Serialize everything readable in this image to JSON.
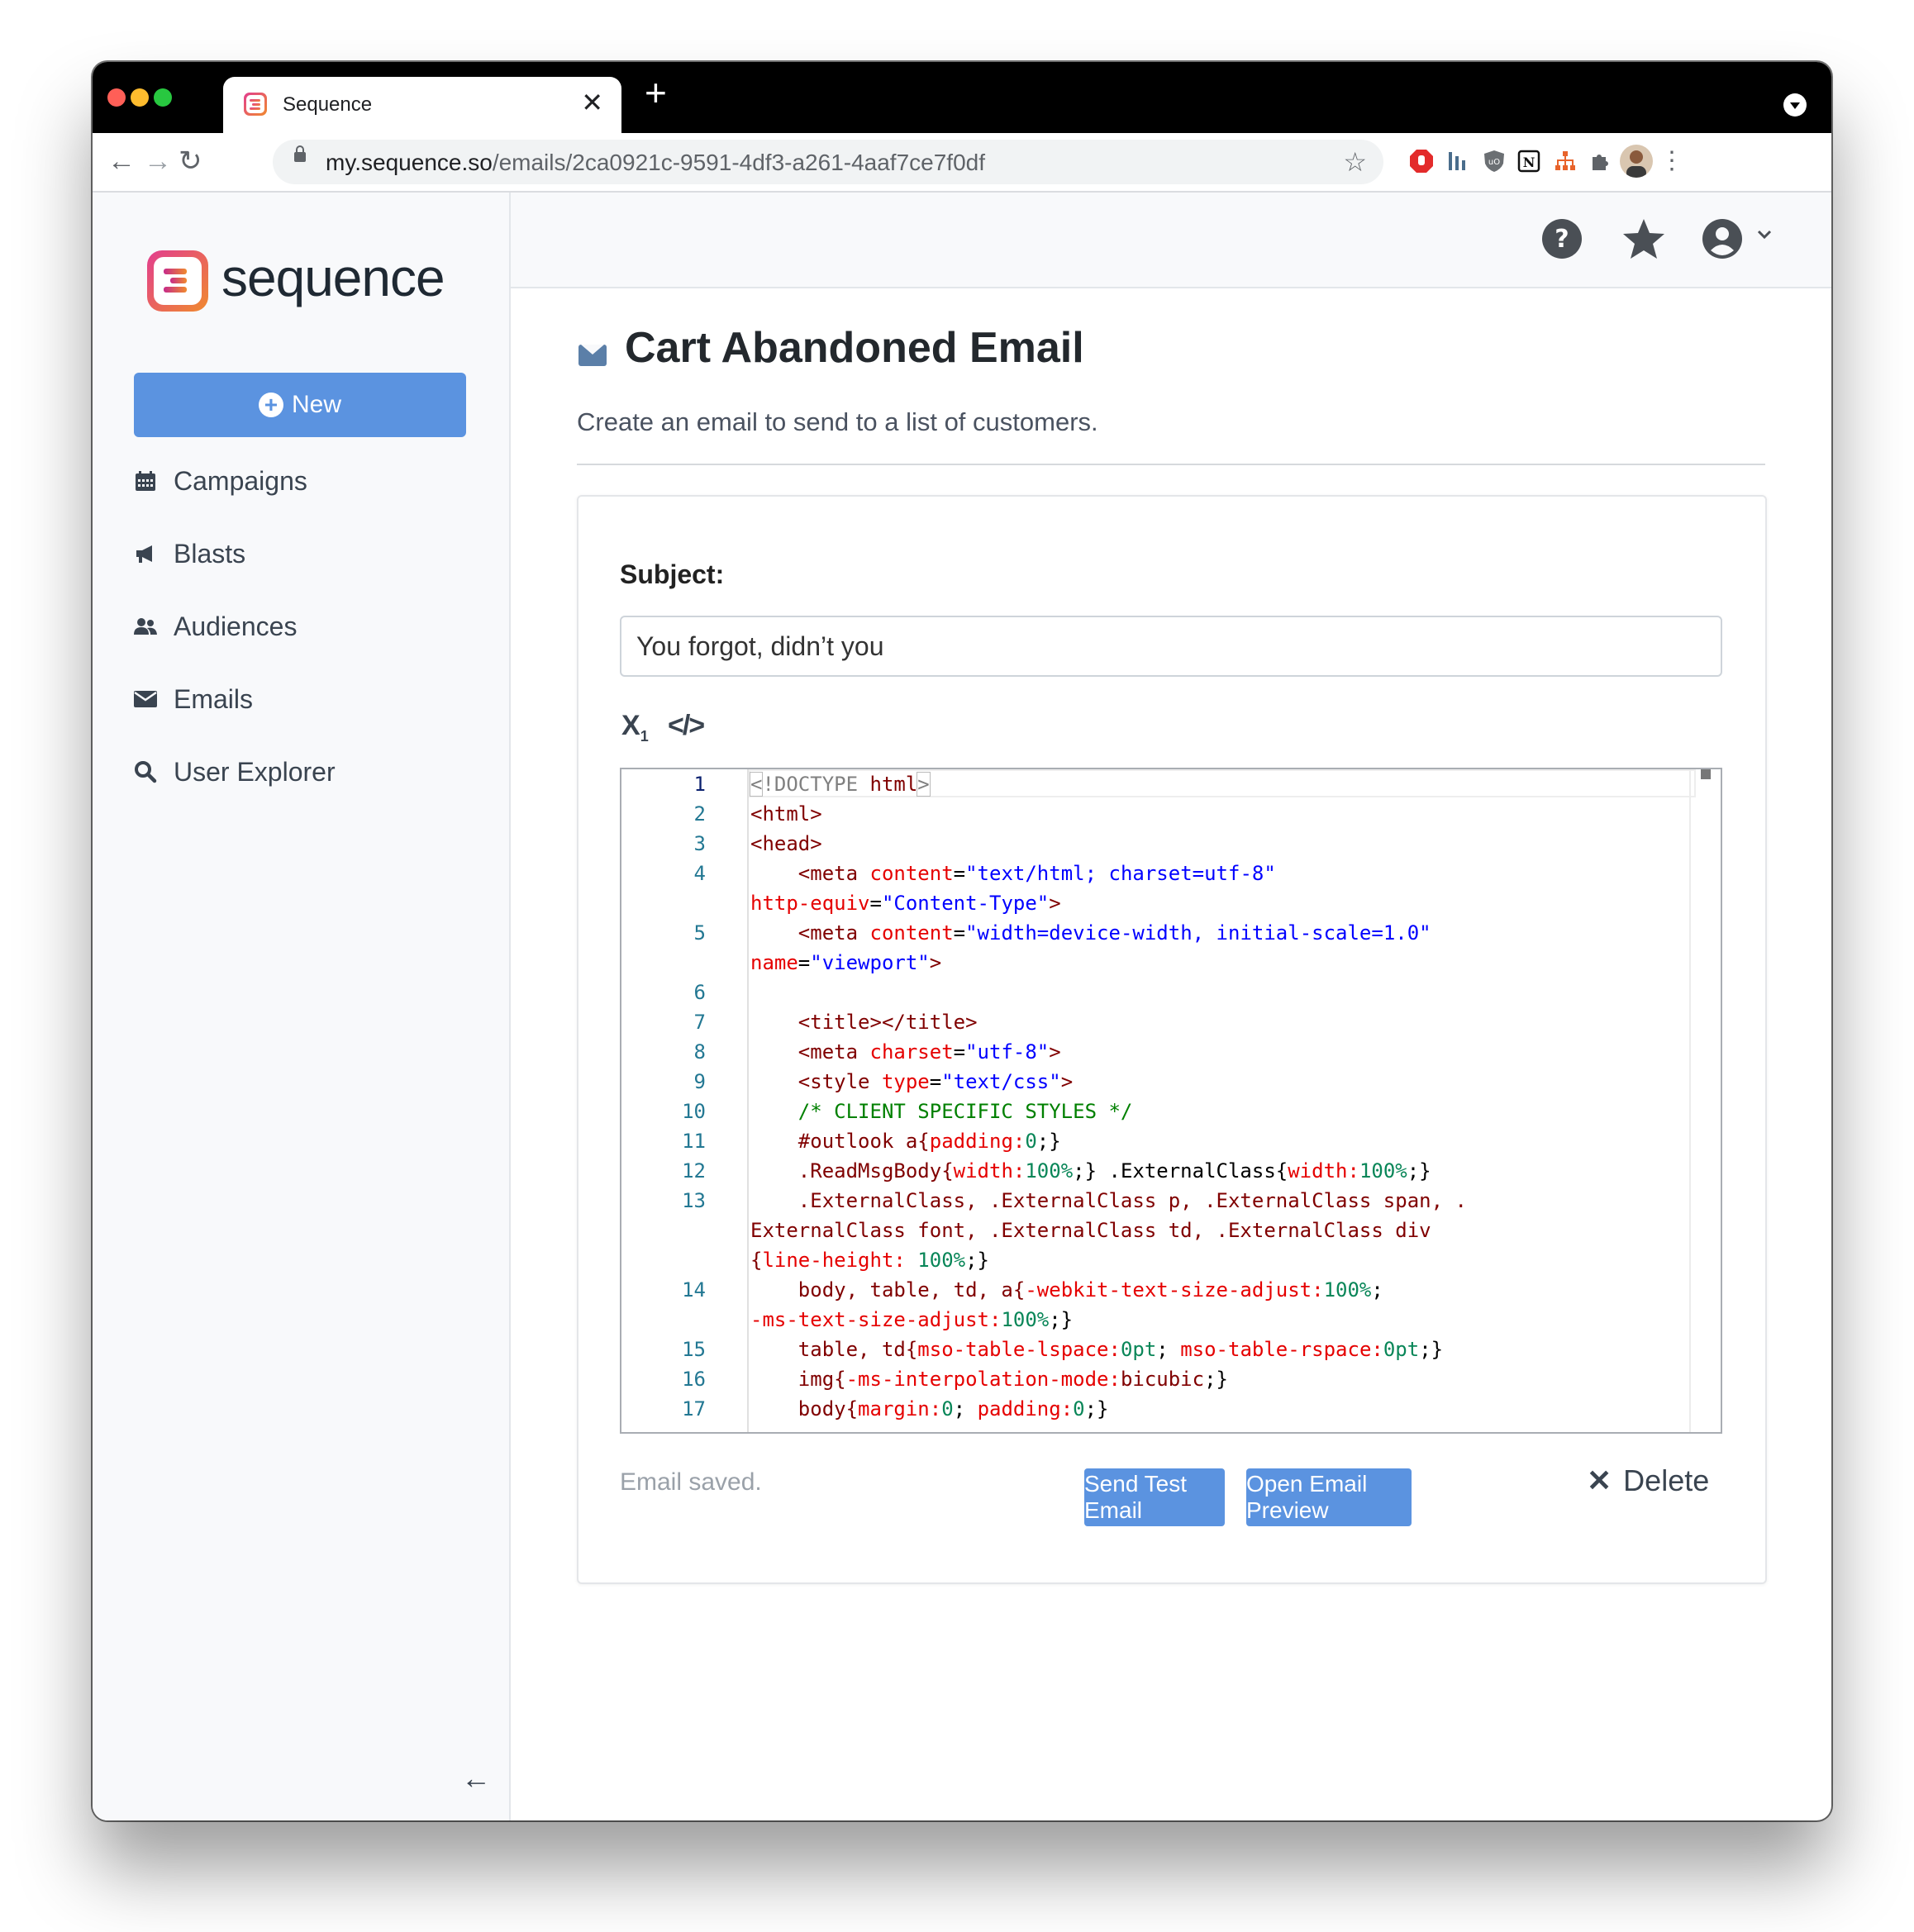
{
  "browser": {
    "tab_title": "Sequence",
    "url_host": "my.sequence.so",
    "url_path": "/emails/2ca0921c-9591-4df3-a261-4aaf7ce7f0df"
  },
  "sidebar": {
    "logo_text": "sequence",
    "new_button": "New",
    "items": [
      {
        "label": "Campaigns",
        "icon": "calendar-icon"
      },
      {
        "label": "Blasts",
        "icon": "megaphone-icon"
      },
      {
        "label": "Audiences",
        "icon": "users-icon"
      },
      {
        "label": "Emails",
        "icon": "envelope-icon"
      },
      {
        "label": "User Explorer",
        "icon": "search-icon"
      }
    ]
  },
  "page": {
    "title": "Cart Abandoned Email",
    "subtitle": "Create an email to send to a list of customers."
  },
  "form": {
    "subject_label": "Subject:",
    "subject_value": "You forgot, didn’t you",
    "status": "Email saved.",
    "send_test": "Send Test Email",
    "open_preview": "Open Email Preview",
    "delete": "Delete"
  },
  "editor": {
    "line_numbers": [
      "1",
      "2",
      "3",
      "4",
      "",
      "5",
      "",
      "6",
      "7",
      "8",
      "9",
      "10",
      "11",
      "12",
      "13",
      "",
      "",
      "14",
      "",
      "15",
      "16",
      "17"
    ],
    "lines": [
      "<!DOCTYPE html>",
      "<html>",
      "<head>",
      "    <meta content=\"text/html; charset=utf-8\"",
      "http-equiv=\"Content-Type\">",
      "    <meta content=\"width=device-width, initial-scale=1.0\"",
      "name=\"viewport\">",
      "",
      "    <title></title>",
      "    <meta charset=\"utf-8\">",
      "    <style type=\"text/css\">",
      "    /* CLIENT SPECIFIC STYLES */",
      "    #outlook a{padding:0;}",
      "    .ReadMsgBody{width:100%;} .ExternalClass{width:100%;}",
      "    .ExternalClass, .ExternalClass p, .ExternalClass span, .",
      "ExternalClass font, .ExternalClass td, .ExternalClass div",
      "{line-height: 100%;}",
      "    body, table, td, a{-webkit-text-size-adjust:100%;",
      "-ms-text-size-adjust:100%;}",
      "    table, td{mso-table-lspace:0pt; mso-table-rspace:0pt;}",
      "    img{-ms-interpolation-mode:bicubic;}",
      "    body{margin:0; padding:0;}"
    ]
  },
  "colors": {
    "accent": "#5b93e0",
    "tag": "#800000",
    "attr": "#e50000",
    "string": "#0000ff",
    "number": "#098658",
    "comment": "#008000",
    "line_number": "#237893"
  }
}
